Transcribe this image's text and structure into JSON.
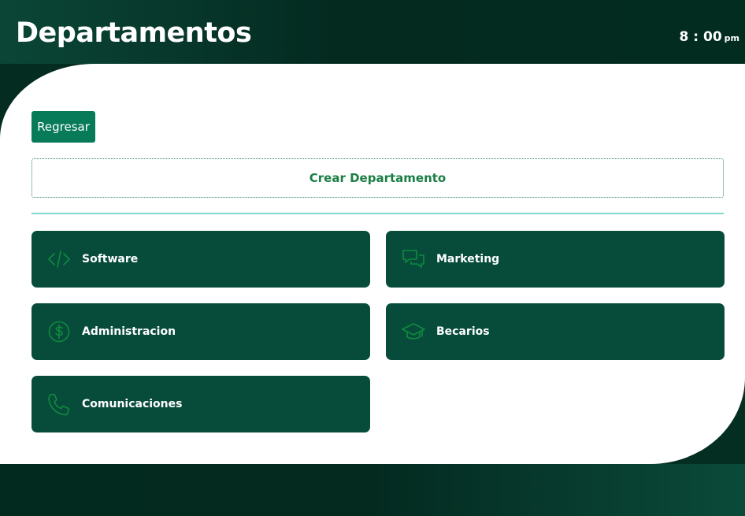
{
  "header": {
    "title": "Departamentos",
    "time": "8 : 00",
    "ampm": "pm"
  },
  "actions": {
    "back_label": "Regresar",
    "create_label": "Crear Departamento"
  },
  "departments": [
    {
      "label": "Software",
      "icon": "code-icon"
    },
    {
      "label": "Marketing",
      "icon": "chat-bubbles-icon"
    },
    {
      "label": "Administracion",
      "icon": "dollar-circle-icon"
    },
    {
      "label": "Becarios",
      "icon": "graduation-cap-icon"
    },
    {
      "label": "Comunicaciones",
      "icon": "phone-icon"
    }
  ],
  "colors": {
    "header_bg": "#042a20",
    "card_bg": "#074c3b",
    "button_bg": "#077a58",
    "icon_green": "#0f8a3c",
    "create_text": "#1b7f45",
    "divider": "#7fd8c9"
  }
}
